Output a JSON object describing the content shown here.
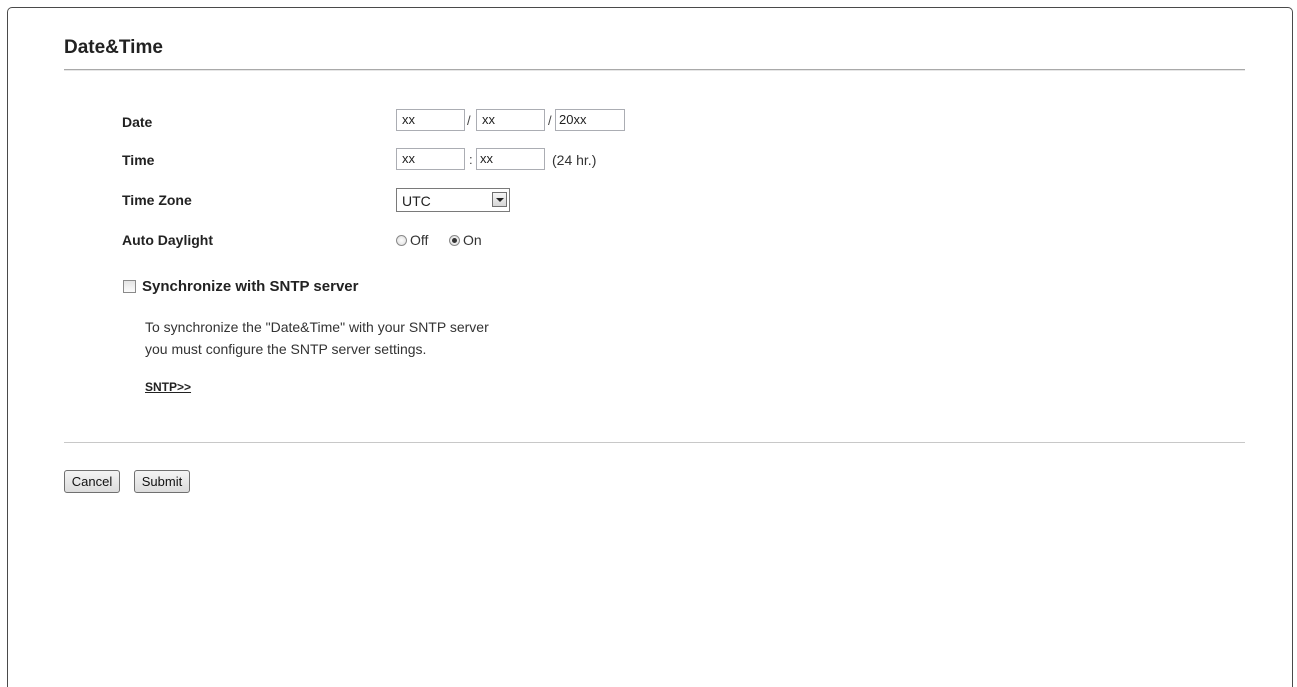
{
  "page": {
    "title": "Date&Time"
  },
  "fields": {
    "date_label": "Date",
    "date_month": "xx",
    "date_sep1": "/",
    "date_day": "xx",
    "date_sep2": "/",
    "date_year": "20xx",
    "time_label": "Time",
    "time_hour": "xx",
    "time_sep": ":",
    "time_minute": "xx",
    "time_unit": "(24 hr.)",
    "timezone_label": "Time Zone",
    "timezone_value": "UTC",
    "daylight_label": "Auto Daylight",
    "daylight_off": "Off",
    "daylight_on": "On",
    "daylight_selected": "On"
  },
  "sntp": {
    "checkbox_label": "Synchronize with SNTP server",
    "checked": false,
    "desc_line1": "To synchronize the \"Date&Time\" with your SNTP server",
    "desc_line2": "you must configure the SNTP server settings.",
    "link": "SNTP>>"
  },
  "actions": {
    "cancel": "Cancel",
    "submit": "Submit"
  }
}
